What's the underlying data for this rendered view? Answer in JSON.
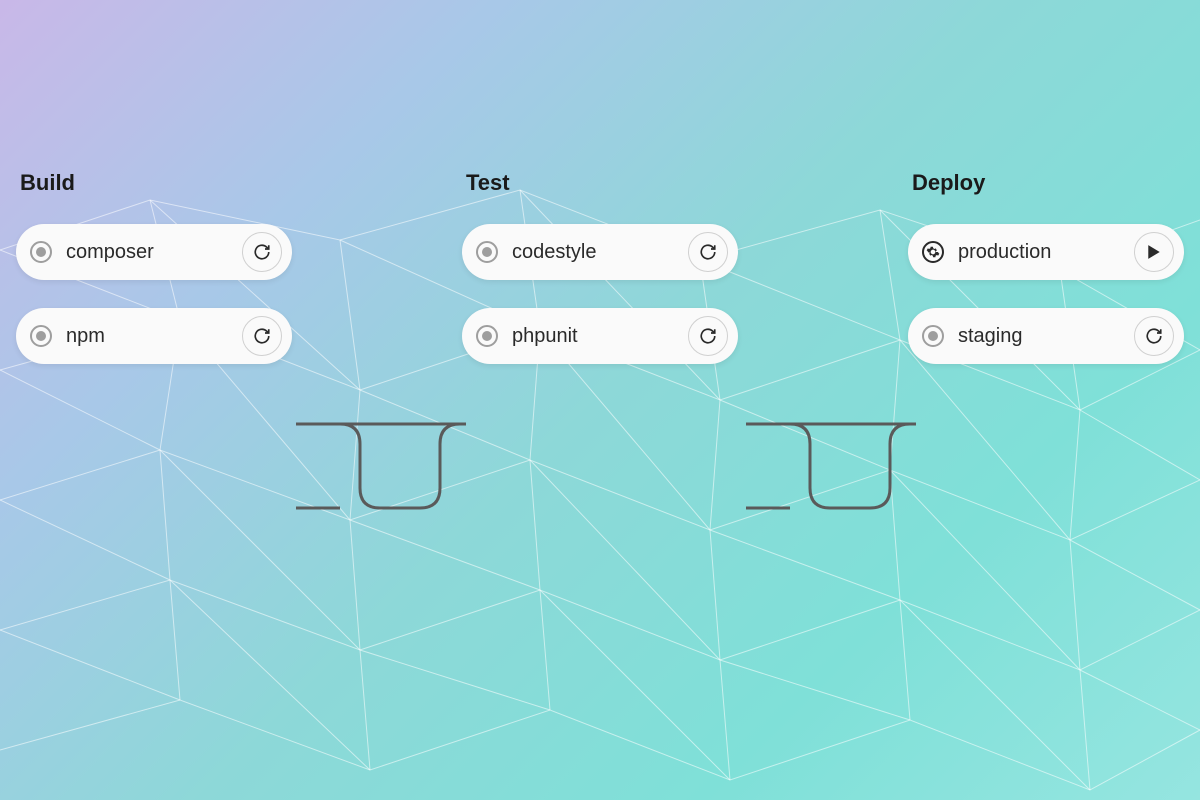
{
  "pipeline": {
    "stages": [
      {
        "title": "Build",
        "jobs": [
          {
            "name": "composer",
            "status": "pending",
            "action": "retry"
          },
          {
            "name": "npm",
            "status": "pending",
            "action": "retry"
          }
        ]
      },
      {
        "title": "Test",
        "jobs": [
          {
            "name": "codestyle",
            "status": "pending",
            "action": "retry"
          },
          {
            "name": "phpunit",
            "status": "pending",
            "action": "retry"
          }
        ]
      },
      {
        "title": "Deploy",
        "jobs": [
          {
            "name": "production",
            "status": "manual",
            "action": "play"
          },
          {
            "name": "staging",
            "status": "pending",
            "action": "retry"
          }
        ]
      }
    ]
  },
  "colors": {
    "connector": "#5a5a5a",
    "mesh": "rgba(255,255,255,0.5)"
  }
}
